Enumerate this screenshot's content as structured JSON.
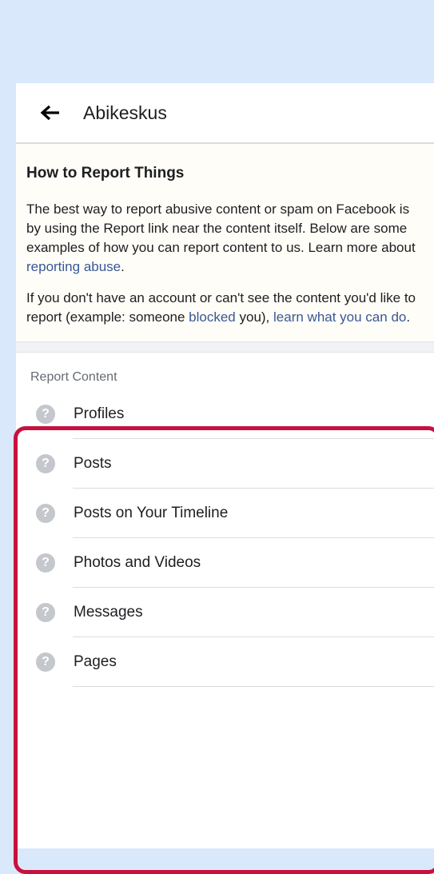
{
  "header": {
    "title": "Abikeskus"
  },
  "info": {
    "title": "How to Report Things",
    "para1_text": "The best way to report abusive content or spam on Facebook is by using the Report link near the content itself. Below are some examples of how you can report content to us. Learn more about ",
    "para1_link": "reporting abuse",
    "para1_end": ".",
    "para2_start": "If you don't have an account or can't see the content you'd like to report (example: someone ",
    "para2_link1": "blocked",
    "para2_mid": " you), ",
    "para2_link2": "learn what you can do",
    "para2_end": "."
  },
  "section": {
    "title": "Report Content",
    "items": [
      {
        "label": "Profiles"
      },
      {
        "label": "Posts"
      },
      {
        "label": "Posts on Your Timeline"
      },
      {
        "label": "Photos and Videos"
      },
      {
        "label": "Messages"
      },
      {
        "label": "Pages"
      }
    ]
  },
  "icons": {
    "back": "back-arrow-icon",
    "item": "question-icon"
  },
  "colors": {
    "link": "#385898",
    "highlight": "#c8103e",
    "background": "#d9e8fb"
  }
}
